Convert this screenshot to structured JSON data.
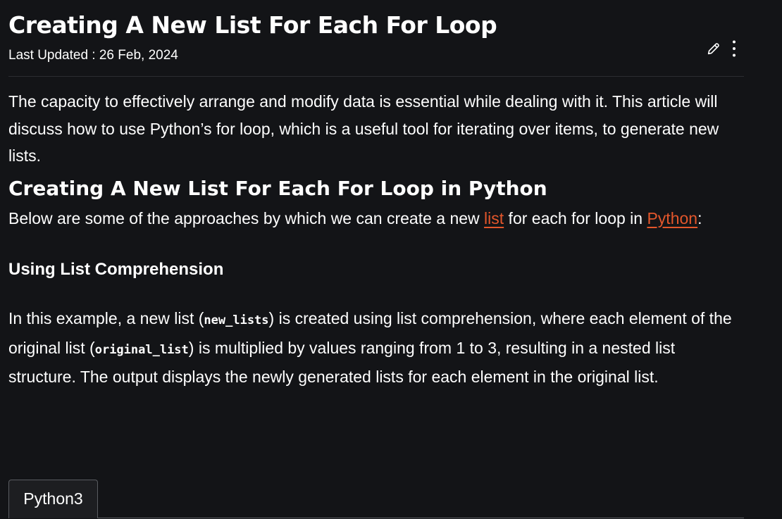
{
  "article": {
    "title": "Creating A New List For Each For Loop",
    "last_updated": "Last Updated : 26 Feb, 2024",
    "intro": "The capacity to effectively arrange and modify data is essential while dealing with it. This article will discuss how to use Python’s for loop, which is a useful tool for iterating over items, to generate new lists.",
    "section_heading": "Creating A New List For Each For Loop in Python",
    "lead": {
      "before": "Below are some of the approaches by which we can create a new ",
      "link1": "list",
      "middle": " for each for loop in ",
      "link2": "Python",
      "after": ":"
    },
    "subheading": "Using List Comprehension",
    "example": {
      "part1": "In this example, a new list (",
      "code1": "new_lists",
      "part2": ") is created using list comprehension, where each element of the original list (",
      "code2": "original_list",
      "part3": ") is multiplied by values ranging from 1 to 3, resulting in a nested list structure. The output displays the newly generated lists for each element in the original list."
    }
  },
  "actions": {
    "edit_icon": "pencil-icon",
    "more_icon": "more-vertical-icon"
  },
  "code_tabs": [
    "Python3"
  ],
  "colors": {
    "background": "#131417",
    "text": "#ffffff",
    "link": "#e3562b",
    "divider": "#2b2d31",
    "tab_border": "#5a5c61"
  }
}
